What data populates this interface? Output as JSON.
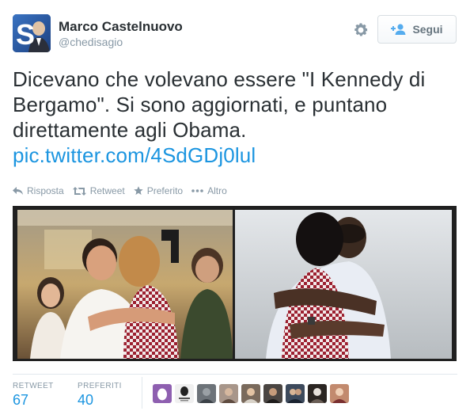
{
  "author": {
    "name": "Marco Castelnuovo",
    "handle": "@chedisagio",
    "avatar_letter": "S"
  },
  "follow_button": {
    "label": "Segui",
    "icon": "add-user-icon"
  },
  "settings_icon": "gear-icon",
  "tweet": {
    "text": "Dicevano che volevano essere \"I Kennedy di Bergamo\". Si sono aggiornati, e puntano direttamente agli Obama.",
    "link": "pic.twitter.com/4SdGDj0lul"
  },
  "actions": [
    {
      "label": "Risposta",
      "icon": "reply-icon"
    },
    {
      "label": "Retweet",
      "icon": "retweet-icon"
    },
    {
      "label": "Preferito",
      "icon": "star-icon"
    },
    {
      "label": "Altro",
      "icon": "more-dots-icon"
    }
  ],
  "stats": {
    "retweet_label": "RETWEET",
    "retweet_count": "67",
    "favorites_label": "PREFERITI",
    "favorites_count": "40"
  },
  "favoriters": [
    {
      "kind": "egg-avatar",
      "color": "#8e5fb0"
    },
    {
      "kind": "text-avatar",
      "color": "#f0f0f0"
    },
    {
      "kind": "photo-avatar",
      "color": "#6d7379"
    },
    {
      "kind": "photo-avatar",
      "color": "#a8968a"
    },
    {
      "kind": "photo-avatar",
      "color": "#7a6a5c"
    },
    {
      "kind": "photo-avatar",
      "color": "#4a4542"
    },
    {
      "kind": "photo-avatar",
      "color": "#3d4a5c"
    },
    {
      "kind": "photo-avatar",
      "color": "#2b2522"
    },
    {
      "kind": "photo-avatar",
      "color": "#c28a6e"
    }
  ],
  "colors": {
    "link_blue": "#1b95e0",
    "muted_gray": "#8899a6",
    "text_dark": "#292f33"
  }
}
